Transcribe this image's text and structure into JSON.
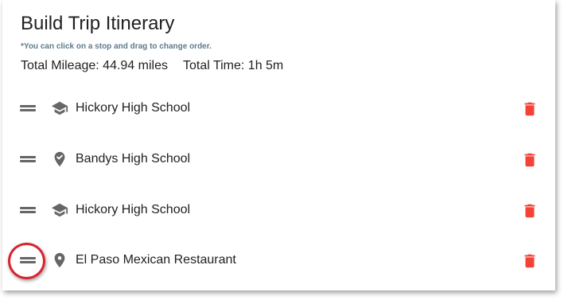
{
  "header": {
    "title": "Build Trip Itinerary",
    "hint": "*You can click on a stop and drag to change order."
  },
  "summary": {
    "mileage": "Total Mileage: 44.94 miles",
    "time": "Total Time: 1h 5m"
  },
  "stops": [
    {
      "label": "Hickory High School",
      "icon": "school-icon"
    },
    {
      "label": "Bandys High School",
      "icon": "place-check-icon"
    },
    {
      "label": "Hickory High School",
      "icon": "school-icon"
    },
    {
      "label": "El Paso Mexican Restaurant",
      "icon": "place-icon"
    }
  ],
  "colors": {
    "delete": "#f44336",
    "icon": "#666666",
    "hint": "#5f7a8a",
    "highlight": "#d9232e"
  }
}
